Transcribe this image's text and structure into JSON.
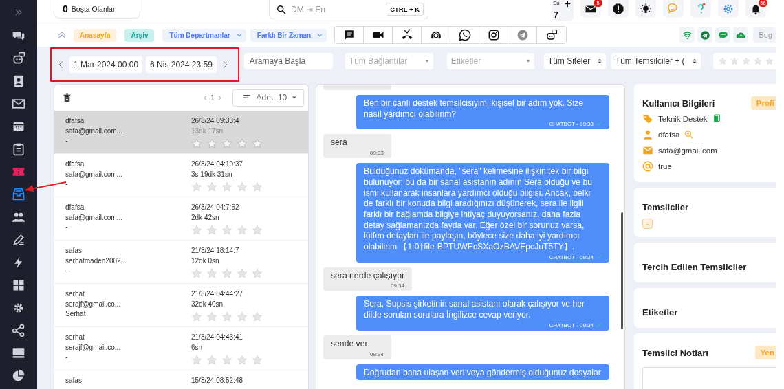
{
  "sidebar": {
    "items": [
      {
        "selected": false
      },
      {
        "selected": false
      },
      {
        "selected": false
      },
      {
        "selected": false
      },
      {
        "selected": false
      },
      {
        "selected": false
      },
      {
        "selected": false
      },
      {
        "selected": true
      },
      {
        "selected": false
      },
      {
        "selected": false
      },
      {
        "selected": false
      },
      {
        "selected": false
      },
      {
        "selected": false
      },
      {
        "selected": false
      },
      {
        "selected": false
      },
      {
        "selected": false
      }
    ]
  },
  "topbar": {
    "idle_count": "0",
    "idle_label": "Boşta Olanlar",
    "search": {
      "placeholder": "DM ⇥ En",
      "shortcut": "CTRL + K"
    },
    "shift": {
      "label": "Su",
      "count": "7",
      "plus": "+"
    },
    "icons": [
      {
        "kind": "mail",
        "badge": "5"
      },
      {
        "kind": "alert"
      },
      {
        "kind": "bulb"
      },
      {
        "kind": "chat"
      },
      {
        "kind": "help"
      },
      {
        "kind": "gear"
      },
      {
        "kind": "bell",
        "badge": "66"
      }
    ]
  },
  "navbar": {
    "tabs": [
      {
        "label": "Anasayfa",
        "kind": "home",
        "selected": false
      },
      {
        "label": "Arşiv",
        "kind": "archive",
        "selected": true
      }
    ],
    "dropdowns": [
      "Tüm Departmanlar",
      "Farklı Bir Zaman"
    ],
    "channels": [
      {
        "kind": "chat"
      },
      {
        "kind": "video"
      },
      {
        "kind": "call"
      },
      {
        "kind": "support"
      },
      {
        "kind": "whatsapp"
      },
      {
        "kind": "instagram"
      },
      {
        "kind": "telegram"
      },
      {
        "kind": "bot"
      }
    ],
    "status_icons": [
      {
        "kind": "wifi"
      },
      {
        "kind": "telegram"
      },
      {
        "kind": "sms"
      },
      {
        "kind": "cloud"
      }
    ],
    "today_button": "Bug"
  },
  "filters": {
    "date_from": "1 Mar 2024 00:00",
    "date_to": "6 Nis 2024 23:59",
    "search_placeholder": "Aramaya Başla",
    "connections_placeholder": "Tüm Bağlantılar",
    "tags_placeholder": "Etiketler",
    "sites": "Tüm Siteler",
    "agents": "Tüm Temsilciler + (",
    "stars": 0
  },
  "list": {
    "page": "1",
    "page_size": "Adet: 10",
    "rows": [
      {
        "name": "dfafsa",
        "email": "safa@gmail.com...",
        "note": "-",
        "date": "26/3/24 09:33:4",
        "duration": "13dk 17sn",
        "stars": 0,
        "selected": true
      },
      {
        "name": "dfafsa",
        "email": "safa@gmail.com...",
        "note": "-",
        "date": "26/3/24 04:10:37",
        "duration": "3s 19dk 31sn",
        "stars": 0,
        "selected": false
      },
      {
        "name": "dfafsa",
        "email": "safa@gmail.com...",
        "note": "-",
        "date": "26/3/24 04:7:52",
        "duration": "2dk 42sn",
        "stars": 0,
        "selected": false
      },
      {
        "name": "safas",
        "email": "serhatmaden2002...",
        "note": "-",
        "date": "21/3/24 18:14:7",
        "duration": "12dk 0sn",
        "stars": 0,
        "selected": false
      },
      {
        "name": "serhat",
        "email": "serajf@gmail.co...",
        "note": "Serhat",
        "date": "21/3/24 04:44:27",
        "duration": "32dk 40sn",
        "stars": 0,
        "selected": false
      },
      {
        "name": "serhat",
        "email": "serajf@gmail.co...",
        "note": "-",
        "date": "21/3/24 04:43:41",
        "duration": "6sn",
        "stars": 0,
        "selected": false
      },
      {
        "name": "safas",
        "date": "15/3/24 08:52:48",
        "selected": false
      }
    ]
  },
  "chat": {
    "messages": [
      {
        "kind": "in"
      },
      {
        "kind": "out",
        "text": "Ben bir canlı destek temsilcisiyim, kişisel bir adım yok. Size nasıl yardımcı olabilirim?",
        "meta": "CHATBOT - 09:33",
        "read": true
      },
      {
        "kind": "in",
        "text": "sera",
        "meta": "09:33"
      },
      {
        "kind": "out",
        "text": "Bulduğunuz dokümanda, \"sera\" kelimesine ilişkin tek bir bilgi bulunuyor; bu da bir sanal asistanın adının Sera olduğu ve bu ismi kullanarak insanlara yardımcı olduğu bilgisi. Ancak, belki de farklı bir konuda bilgi aradığınızı düşünerek, sera ile ilgili farklı bir bağlamda bilgiye ihtiyaç duyuyorsanız, daha fazla detay sağlamanızda fayda var. Eğer özel bir sorunuz varsa, lütfen detayları ile paylaşın, böylece size daha iyi yardımcı olabilirim 【1:0†file-BPTUWEcSXaOzBAVEpcJuT5TY】.",
        "meta": "CHATBOT - 09:34",
        "read": true
      },
      {
        "kind": "in",
        "text": "sera nerde çalışıyor",
        "meta": "09:34"
      },
      {
        "kind": "out",
        "text": "Sera, Supsis şirketinin sanal asistanı olarak çalışıyor ve her dilde sorulan sorulara İngilizce cevap veriyor.",
        "meta": "CHATBOT - 09:34",
        "read": true
      },
      {
        "kind": "in",
        "text": "sende ver",
        "meta": "09:34"
      },
      {
        "kind": "out",
        "text": "Doğrudan bana ulaşan veri veya göndermiş olduğunuz dosyalar"
      }
    ]
  },
  "details": {
    "user_card": {
      "title": "Kullanıcı Bilgileri",
      "button": "Profi",
      "items": [
        {
          "kind": "tag",
          "text": "Teknik Destek",
          "copy": true
        },
        {
          "kind": "person",
          "text": "dfafsa",
          "lookup": true
        },
        {
          "kind": "mail",
          "text": "safa@gmail.com"
        },
        {
          "kind": "at",
          "text": "true"
        }
      ]
    },
    "cards": [
      {
        "title": "Temsilciler",
        "chip": "-"
      },
      {
        "title": "Tercih Edilen Temsilciler"
      },
      {
        "title": "Etiketler"
      },
      {
        "title": "Temsilci Notları",
        "button": "Yen",
        "notes": true
      }
    ]
  }
}
